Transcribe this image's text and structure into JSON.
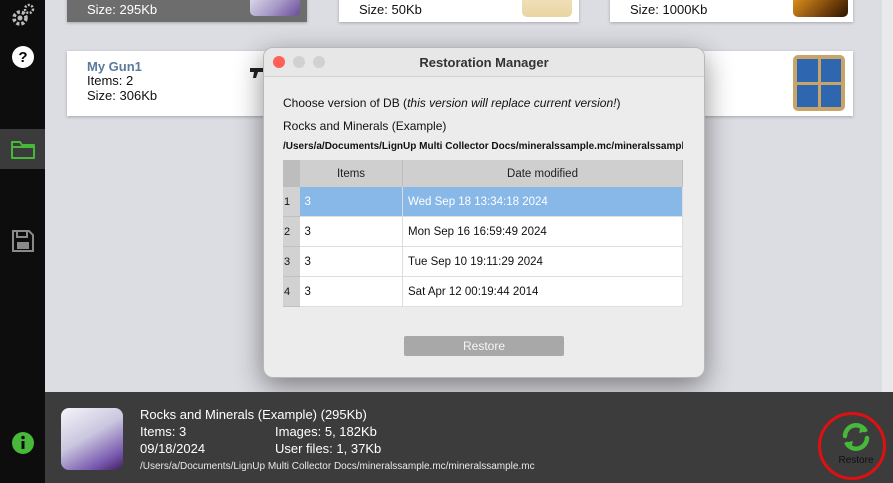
{
  "sidebar": {
    "items": [
      {
        "icon": "gear-icon"
      },
      {
        "icon": "help-icon"
      },
      {
        "icon": "folder-icon",
        "active": true
      },
      {
        "icon": "save-icon"
      },
      {
        "icon": "info-icon"
      }
    ]
  },
  "cards": {
    "top_left_size": "Size: 295Kb",
    "top_mid_size": "Size: 50Kb",
    "top_right_size": "Size: 1000Kb",
    "gun": {
      "title": "My Gun1",
      "items": "Items: 2",
      "size": "Size: 306Kb"
    }
  },
  "dialog": {
    "title": "Restoration Manager",
    "instruction_prefix": "Choose version of DB (",
    "instruction_italic": "this version will replace current version!",
    "instruction_suffix": ")",
    "db_name": "Rocks and Minerals (Example)",
    "path": "/Users/a/Documents/LignUp Multi Collector Docs/mineralssample.mc/mineralssampl",
    "columns": [
      "Items",
      "Date modified"
    ],
    "rows": [
      {
        "num": "1",
        "items": "3",
        "date": "Wed Sep 18 13:34:18 2024",
        "selected": true
      },
      {
        "num": "2",
        "items": "3",
        "date": "Mon Sep 16 16:59:49 2024"
      },
      {
        "num": "3",
        "items": "3",
        "date": "Tue Sep 10 19:11:29 2024"
      },
      {
        "num": "4",
        "items": "3",
        "date": "Sat Apr 12 00:19:44 2014"
      }
    ],
    "restore_label": "Restore"
  },
  "bottom": {
    "title": "Rocks and Minerals (Example) (295Kb)",
    "items": "Items: 3",
    "images": "Images: 5,  182Kb",
    "date": "09/18/2024",
    "user_files": "User files: 1,  37Kb",
    "path": "/Users/a/Documents/LignUp Multi Collector Docs/mineralssample.mc/mineralssample.mc",
    "restore_label": "Restore"
  },
  "colors": {
    "accent_green": "#48b83a",
    "highlight_red": "#e01010",
    "selection_blue": "#88b8e8"
  }
}
